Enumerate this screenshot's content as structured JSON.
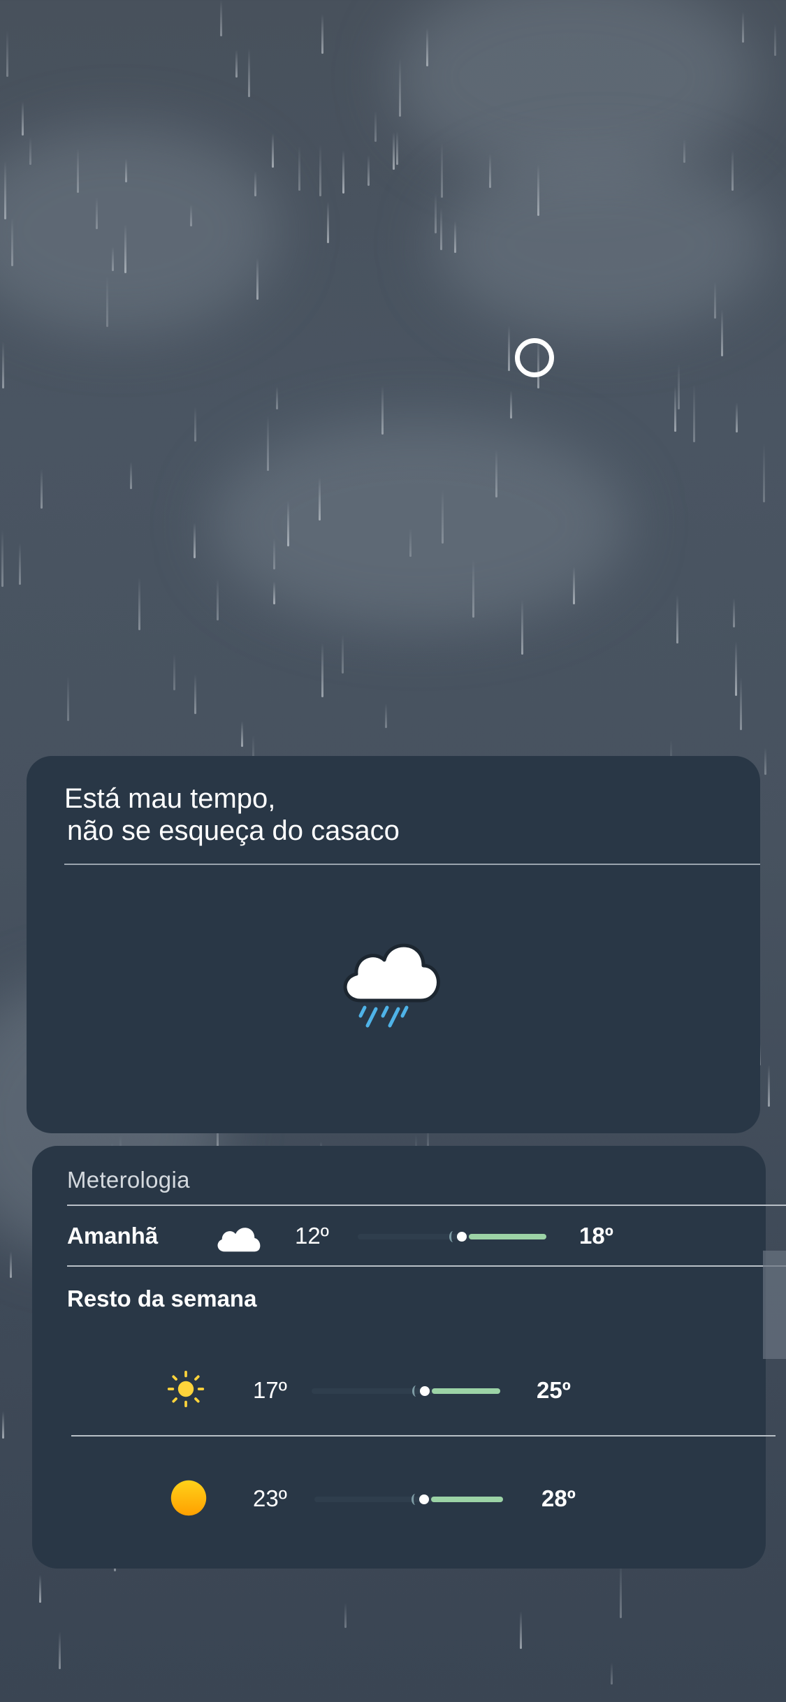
{
  "status": {
    "loading_indicator": "circle-loader"
  },
  "colors": {
    "card_background": "#293746",
    "range_fill": "#9cd3a6",
    "sun_yellow": "#ffd43b",
    "rain_blue": "#4fb3e8"
  },
  "summary": {
    "message_line1": "Está mau tempo,",
    "message_line2": "não se esqueça do casaco",
    "icon": "cloud-rain-icon"
  },
  "forecast": {
    "title": "Meterologia",
    "tomorrow": {
      "label": "Amanhã",
      "icon": "cloud-icon",
      "low": "12º",
      "high": "18º",
      "range_start": 0.55,
      "range_end": 1.0
    },
    "week_title": "Resto da semana",
    "week": [
      {
        "icon": "sun-outline-icon",
        "low": "17º",
        "high": "25º",
        "range_start": 0.6,
        "range_end": 1.0
      },
      {
        "icon": "sun-filled-icon",
        "low": "23º",
        "high": "28º",
        "range_start": 0.58,
        "range_end": 1.0
      }
    ]
  }
}
